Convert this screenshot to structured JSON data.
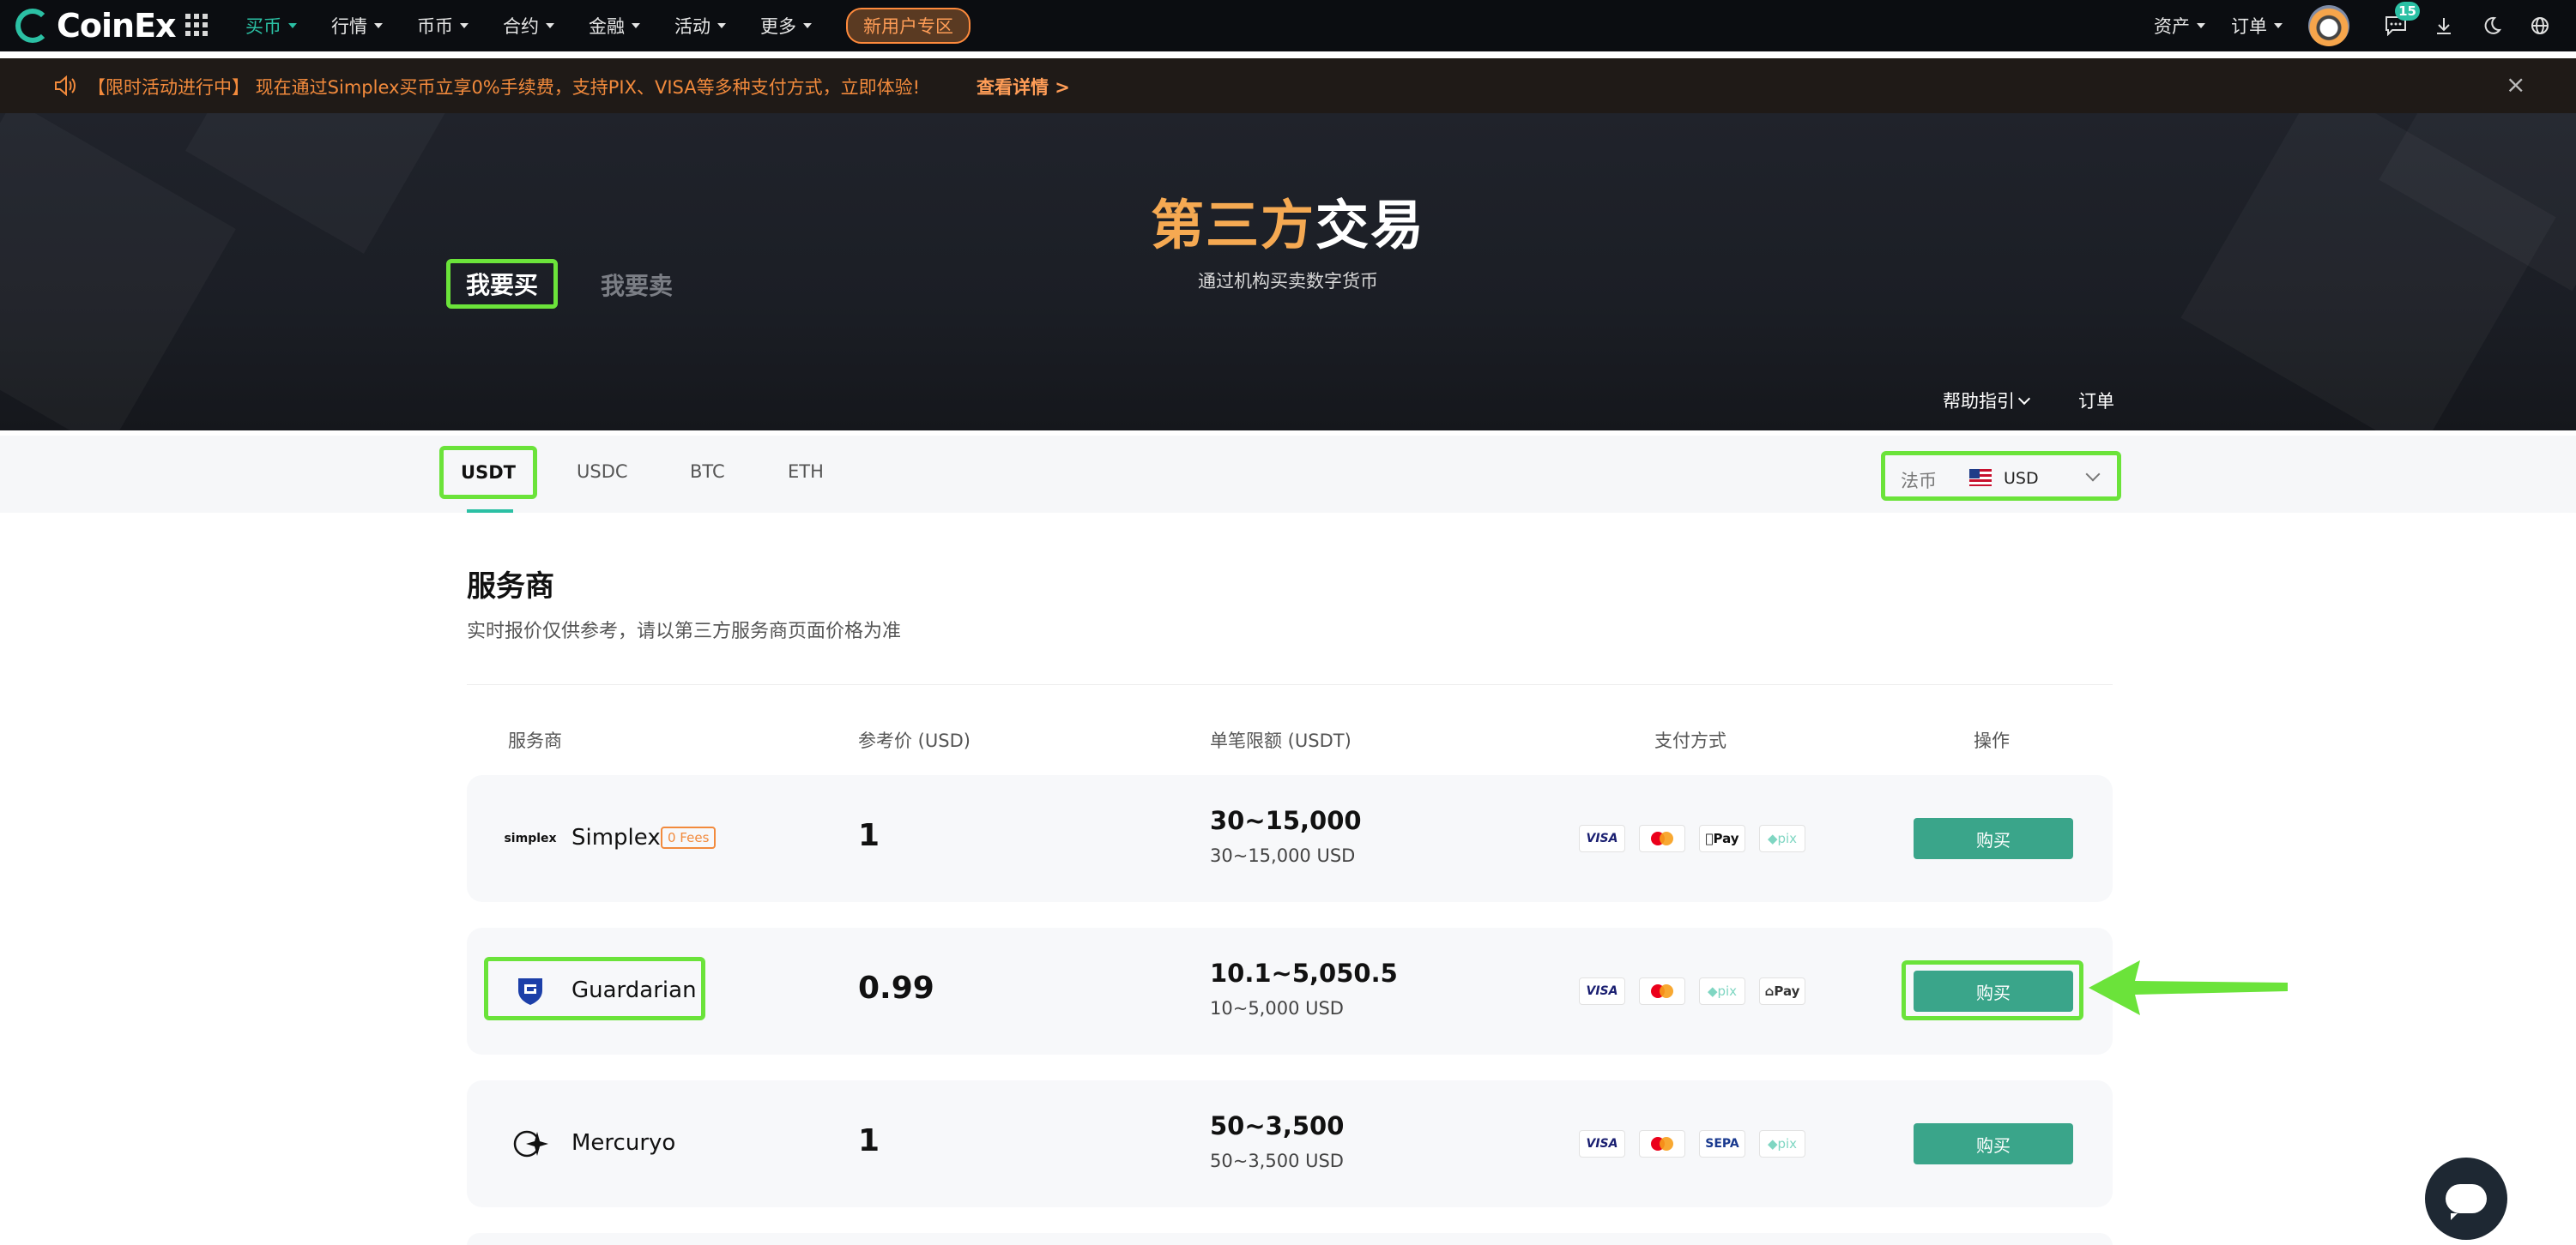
{
  "nav": {
    "logo_text": "CoinEx",
    "menu": [
      {
        "label": "买币",
        "active": true
      },
      {
        "label": "行情"
      },
      {
        "label": "币币"
      },
      {
        "label": "合约"
      },
      {
        "label": "金融"
      },
      {
        "label": "活动"
      },
      {
        "label": "更多"
      }
    ],
    "new_user_label": "新用户专区",
    "assets_label": "资产",
    "orders_label": "订单",
    "message_count": "15"
  },
  "promo": {
    "text": "【限时活动进行中】 现在通过Simplex买币立享0%手续费，支持PIX、VISA等多种支付方式，立即体验!",
    "link_label": "查看详情 >",
    "close_glyph": "×"
  },
  "hero": {
    "title_highlight": "第三方",
    "title_rest": "交易",
    "subtitle": "通过机构买卖数字货币",
    "tab_buy": "我要买",
    "tab_sell": "我要卖",
    "help_label": "帮助指引",
    "orders_label": "订单"
  },
  "coins": {
    "tabs": [
      "USDT",
      "USDC",
      "BTC",
      "ETH"
    ],
    "active": "USDT",
    "fiat_label": "法币",
    "fiat_value": "USD"
  },
  "providers": {
    "title": "服务商",
    "subtitle": "实时报价仅供参考，请以第三方服务商页面价格为准",
    "columns": {
      "provider": "服务商",
      "price": "参考价 (USD)",
      "limit": "单笔限额 (USDT)",
      "payment": "支付方式",
      "action": "操作"
    },
    "rows": [
      {
        "name": "Simplex",
        "badge": "0 Fees",
        "logo_text": "simplex",
        "price": "1",
        "limit": "30~15,000",
        "limit_sub": "30~15,000 USD",
        "payments": [
          "VISA",
          "Mastercard",
          "Pay",
          "pix"
        ],
        "action": "购买"
      },
      {
        "name": "Guardarian",
        "badge": "",
        "price": "0.99",
        "limit": "10.1~5,050.5",
        "limit_sub": "10~5,000 USD",
        "payments": [
          "VISA",
          "Mastercard",
          "pix",
          "Pay"
        ],
        "action": "购买"
      },
      {
        "name": "Mercuryo",
        "badge": "",
        "price": "1",
        "limit": "50~3,500",
        "limit_sub": "50~3,500 USD",
        "payments": [
          "VISA",
          "Mastercard",
          "SEPA",
          "pix"
        ],
        "action": "购买"
      }
    ]
  },
  "colors": {
    "accent": "#2bc0a4",
    "buy_button": "#3aa58a",
    "highlight": "#6be33a",
    "promo_text": "#f28a3c"
  }
}
